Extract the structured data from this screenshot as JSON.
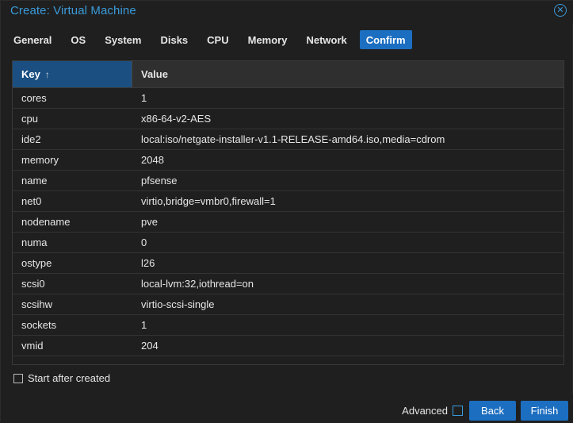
{
  "dialog": {
    "title": "Create: Virtual Machine",
    "close_icon": "close-circle-icon"
  },
  "tabs": [
    {
      "label": "General"
    },
    {
      "label": "OS"
    },
    {
      "label": "System"
    },
    {
      "label": "Disks"
    },
    {
      "label": "CPU"
    },
    {
      "label": "Memory"
    },
    {
      "label": "Network"
    },
    {
      "label": "Confirm",
      "active": true
    }
  ],
  "grid": {
    "columns": {
      "key": "Key",
      "value": "Value",
      "sort_icon": "arrow-up-icon",
      "sort_arrow": "↑"
    },
    "rows": [
      {
        "key": "cores",
        "value": "1"
      },
      {
        "key": "cpu",
        "value": "x86-64-v2-AES"
      },
      {
        "key": "ide2",
        "value": "local:iso/netgate-installer-v1.1-RELEASE-amd64.iso,media=cdrom"
      },
      {
        "key": "memory",
        "value": "2048"
      },
      {
        "key": "name",
        "value": "pfsense"
      },
      {
        "key": "net0",
        "value": "virtio,bridge=vmbr0,firewall=1"
      },
      {
        "key": "nodename",
        "value": "pve"
      },
      {
        "key": "numa",
        "value": "0"
      },
      {
        "key": "ostype",
        "value": "l26"
      },
      {
        "key": "scsi0",
        "value": "local-lvm:32,iothread=on"
      },
      {
        "key": "scsihw",
        "value": "virtio-scsi-single"
      },
      {
        "key": "sockets",
        "value": "1"
      },
      {
        "key": "vmid",
        "value": "204"
      }
    ]
  },
  "start_after_created": {
    "label": "Start after created",
    "checked": false
  },
  "footer": {
    "advanced_label": "Advanced",
    "advanced_checked": false,
    "back_label": "Back",
    "finish_label": "Finish"
  },
  "colors": {
    "accent": "#1c6ec0",
    "title": "#3a9ad9",
    "background": "#1f1f1f"
  }
}
